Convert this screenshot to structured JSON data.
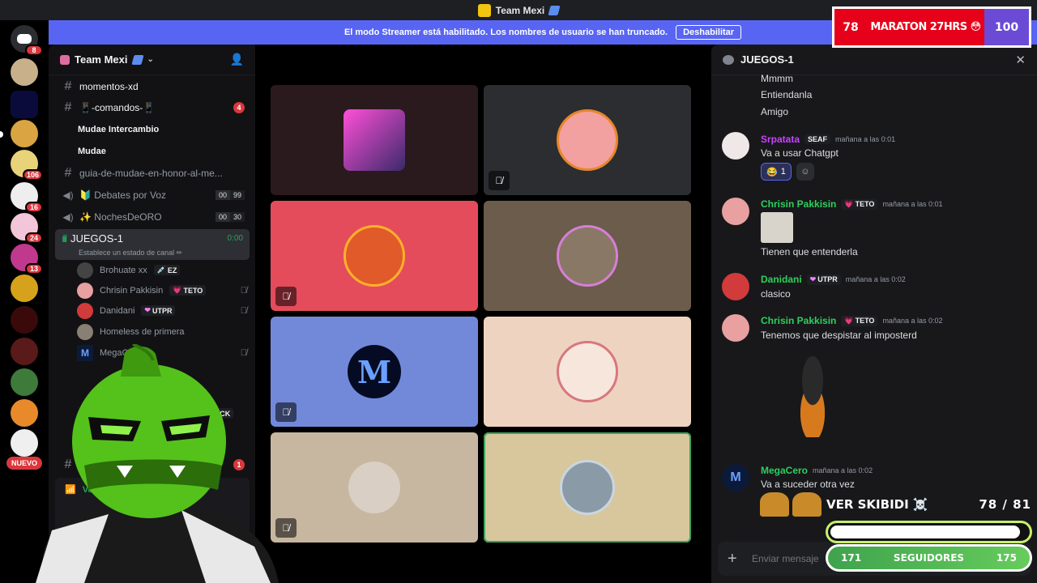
{
  "window": {
    "title": "Team Mexi"
  },
  "rail": {
    "badges": [
      "8",
      "106",
      "16",
      "24",
      "13"
    ],
    "nuevo_label": "NUEVO"
  },
  "banner": {
    "text": "El modo Streamer está habilitado. Los nombres de usuario se han truncado.",
    "button_label": "Deshabilitar"
  },
  "guild": {
    "name": "Team Mexi"
  },
  "channels": {
    "momentos": {
      "name": "momentos-xd"
    },
    "comandos": {
      "name": "📱-comandos-📱",
      "mentions": "4"
    },
    "mudae_intercambio": {
      "name": "Mudae Intercambio"
    },
    "mudae": {
      "name": "Mudae"
    },
    "guia": {
      "name": "guia-de-mudae-en-honor-al-me..."
    },
    "debates": {
      "name": "🔰 Debates por Voz",
      "count_a": "00",
      "count_b": "99"
    },
    "noches": {
      "name": "✨ NochesDeORO",
      "count_a": "00",
      "count_b": "30"
    },
    "juegos": {
      "name": "JUEGOS-1",
      "timer": "0:00",
      "status": "Establece un estado de canal ✏"
    },
    "bottom_mention": "1"
  },
  "voice_users": [
    {
      "name": "Brohuate xx",
      "tag": "EZ",
      "tag_icon": "💉"
    },
    {
      "name": "Chrisin Pakkisin",
      "tag": "TETO",
      "tag_icon": "💗"
    },
    {
      "name": "Danidani",
      "tag": "UTPR",
      "tag_icon": "❤"
    },
    {
      "name": "Homeless de primera",
      "tag": "",
      "tag_icon": ""
    },
    {
      "name": "MegaC",
      "tag": "",
      "tag_icon": ""
    }
  ],
  "kick_tag": "KICK",
  "voice_panel": {
    "label": "Voz con"
  },
  "chat": {
    "title": "JUEGOS-1",
    "early_lines": [
      "Mmmm",
      "Entiendanla",
      "Amigo"
    ],
    "messages": [
      {
        "author": "Srpatata",
        "tag": "SEAF",
        "time": "mañana a las 0:01",
        "text": "Va a usar Chatgpt",
        "color": "#c644ff"
      },
      {
        "author": "Chrisin Pakkisin",
        "tag": "TETO",
        "time": "mañana a las 0:01",
        "text": "Tienen que entenderla",
        "color": "#2dd05c"
      },
      {
        "author": "Danidani",
        "tag": "UTPR",
        "time": "mañana a las 0:02",
        "text": "clasico",
        "color": "#2dd05c"
      },
      {
        "author": "Chrisin Pakkisin",
        "tag": "TETO",
        "time": "mañana a las 0:02",
        "text": "Tenemos que despistar al imposterd",
        "color": "#2dd05c"
      },
      {
        "author": "MegaCero",
        "tag": "",
        "time": "mañana a las 0:02",
        "text": "Va a suceder otra vez",
        "color": "#2dd05c"
      }
    ],
    "reaction": {
      "emoji": "😂",
      "count": "1"
    },
    "input_placeholder": "Enviar mensaje"
  },
  "overlays": {
    "marathon": {
      "left": "78",
      "label": "MARATON 27HRS 😳",
      "right": "100"
    },
    "skibidi": {
      "label": "VER SKIBIDI ☠️",
      "count": "78  / 81",
      "progress": 0.963
    },
    "followers": {
      "left": "171",
      "label": "SEGUIDORES",
      "right": "175"
    }
  },
  "colors": {
    "accent": "#5865f2",
    "speaking": "#3ba55d",
    "mention": "#da373c",
    "tiles": [
      "#2a1a1e",
      "#2b2d31",
      "#e44c5c",
      "#6b5c4c",
      "#7289da",
      "#efd3c1",
      "#c7b7a0",
      "#d8c79d"
    ]
  }
}
